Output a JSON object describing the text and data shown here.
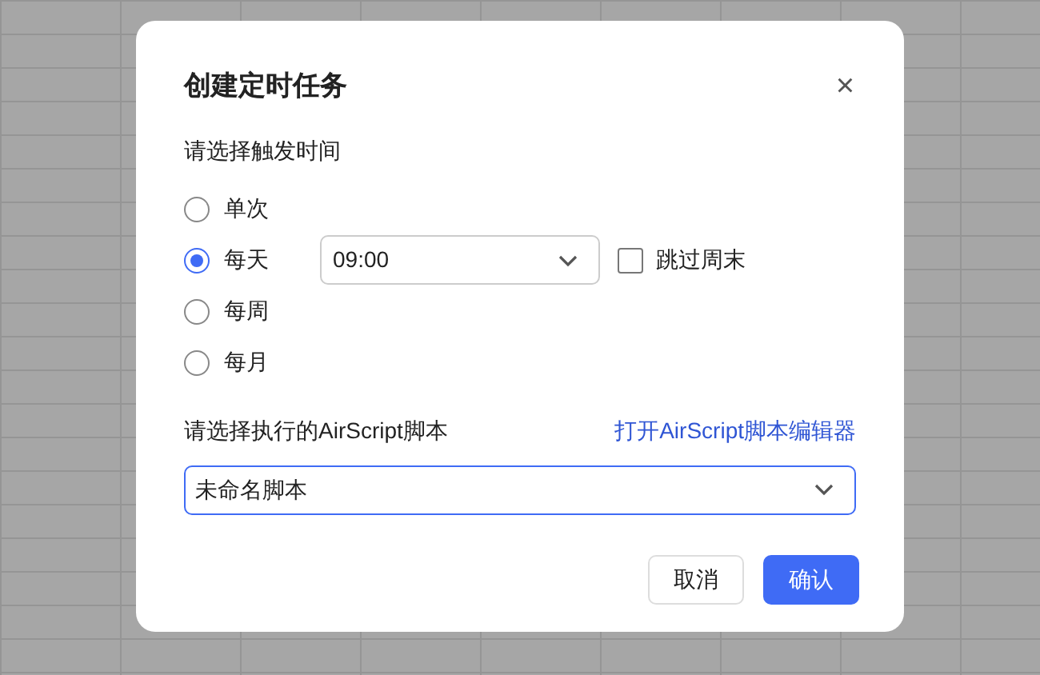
{
  "dialog": {
    "title": "创建定时任务",
    "close_label": "×"
  },
  "trigger": {
    "label": "请选择触发时间",
    "options": [
      {
        "label": "单次",
        "selected": false
      },
      {
        "label": "每天",
        "selected": true
      },
      {
        "label": "每周",
        "selected": false
      },
      {
        "label": "每月",
        "selected": false
      }
    ],
    "time": {
      "value": "09:00"
    },
    "skip_weekends": {
      "label": "跳过周末",
      "checked": false
    }
  },
  "script": {
    "label": "请选择执行的AirScript脚本",
    "link": "打开AirScript脚本编辑器",
    "value": "未命名脚本"
  },
  "buttons": [
    {
      "label": "取消",
      "kind": "secondary"
    },
    {
      "label": "确认",
      "kind": "primary"
    }
  ]
}
